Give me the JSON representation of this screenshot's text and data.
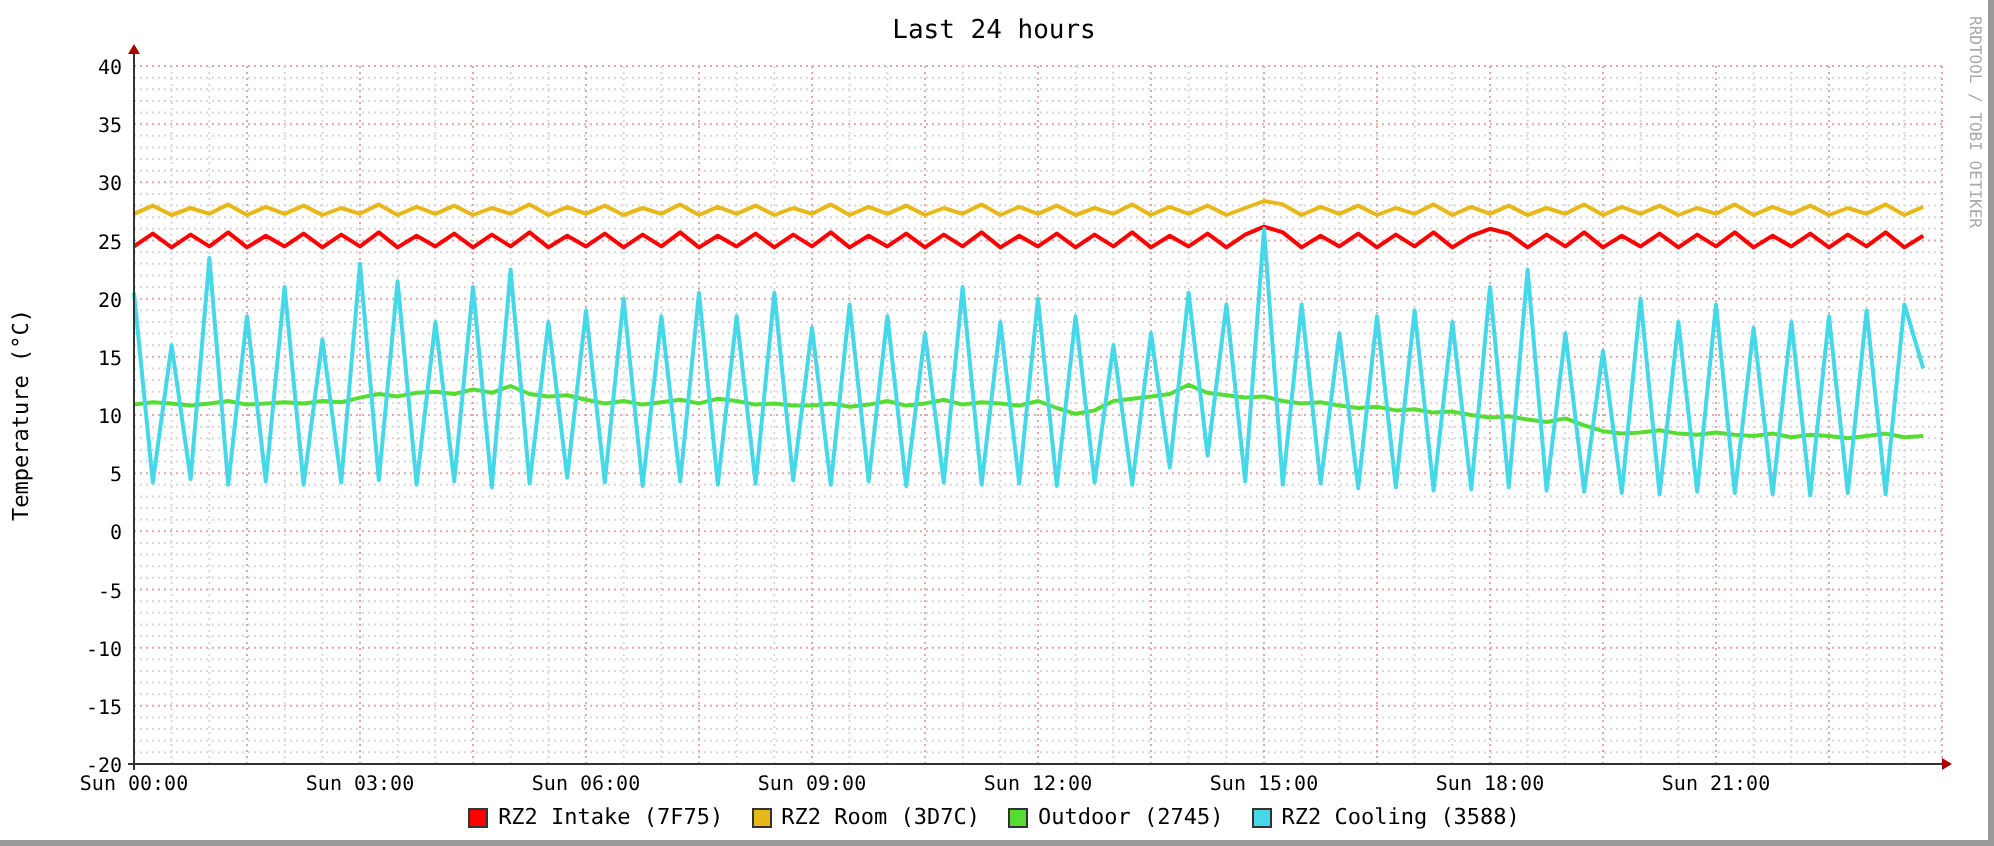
{
  "credit": "RRDTOOL / TOBI OETIKER",
  "chart_data": {
    "type": "line",
    "title": "Last 24 hours",
    "ylabel": "Temperature (°C)",
    "categories": [
      "Sun 00:00",
      null,
      null,
      null,
      null,
      null,
      null,
      null,
      null,
      null,
      null,
      null,
      "Sun 03:00",
      null,
      null,
      null,
      null,
      null,
      null,
      null,
      null,
      null,
      null,
      null,
      "Sun 06:00",
      null,
      null,
      null,
      null,
      null,
      null,
      null,
      null,
      null,
      null,
      null,
      "Sun 09:00",
      null,
      null,
      null,
      null,
      null,
      null,
      null,
      null,
      null,
      null,
      null,
      "Sun 12:00",
      null,
      null,
      null,
      null,
      null,
      null,
      null,
      null,
      null,
      null,
      null,
      "Sun 15:00",
      null,
      null,
      null,
      null,
      null,
      null,
      null,
      null,
      null,
      null,
      null,
      "Sun 18:00",
      null,
      null,
      null,
      null,
      null,
      null,
      null,
      null,
      null,
      null,
      null,
      "Sun 21:00",
      null,
      null,
      null,
      null,
      null,
      null,
      null,
      null,
      null,
      null,
      null
    ],
    "series": [
      {
        "name": "RZ2 Intake (7F75)",
        "color": "#ff0000",
        "values": [
          24.5,
          25.6,
          24.4,
          25.5,
          24.5,
          25.7,
          24.4,
          25.4,
          24.5,
          25.6,
          24.4,
          25.5,
          24.5,
          25.7,
          24.4,
          25.4,
          24.5,
          25.6,
          24.4,
          25.5,
          24.5,
          25.7,
          24.4,
          25.4,
          24.5,
          25.6,
          24.4,
          25.5,
          24.5,
          25.7,
          24.4,
          25.4,
          24.5,
          25.6,
          24.4,
          25.5,
          24.5,
          25.7,
          24.4,
          25.4,
          24.5,
          25.6,
          24.4,
          25.5,
          24.5,
          25.7,
          24.4,
          25.4,
          24.5,
          25.6,
          24.4,
          25.5,
          24.5,
          25.7,
          24.4,
          25.4,
          24.5,
          25.6,
          24.4,
          25.5,
          26.2,
          25.7,
          24.4,
          25.4,
          24.5,
          25.6,
          24.4,
          25.5,
          24.5,
          25.7,
          24.4,
          25.4,
          26.0,
          25.6,
          24.4,
          25.5,
          24.5,
          25.7,
          24.4,
          25.4,
          24.5,
          25.6,
          24.4,
          25.5,
          24.5,
          25.7,
          24.4,
          25.4,
          24.5,
          25.6,
          24.4,
          25.5,
          24.5,
          25.7,
          24.4,
          25.4
        ]
      },
      {
        "name": "RZ2 Room (3D7C)",
        "color": "#e8b818",
        "values": [
          27.3,
          28.0,
          27.2,
          27.8,
          27.3,
          28.1,
          27.2,
          27.9,
          27.3,
          28.0,
          27.2,
          27.8,
          27.3,
          28.1,
          27.2,
          27.9,
          27.3,
          28.0,
          27.2,
          27.8,
          27.3,
          28.1,
          27.2,
          27.9,
          27.3,
          28.0,
          27.2,
          27.8,
          27.3,
          28.1,
          27.2,
          27.9,
          27.3,
          28.0,
          27.2,
          27.8,
          27.3,
          28.1,
          27.2,
          27.9,
          27.3,
          28.0,
          27.2,
          27.8,
          27.3,
          28.1,
          27.2,
          27.9,
          27.3,
          28.0,
          27.2,
          27.8,
          27.3,
          28.1,
          27.2,
          27.9,
          27.3,
          28.0,
          27.2,
          27.8,
          28.4,
          28.1,
          27.2,
          27.9,
          27.3,
          28.0,
          27.2,
          27.8,
          27.3,
          28.1,
          27.2,
          27.9,
          27.3,
          28.0,
          27.2,
          27.8,
          27.3,
          28.1,
          27.2,
          27.9,
          27.3,
          28.0,
          27.2,
          27.8,
          27.3,
          28.1,
          27.2,
          27.9,
          27.3,
          28.0,
          27.2,
          27.8,
          27.3,
          28.1,
          27.2,
          27.9
        ]
      },
      {
        "name": "Outdoor (2745)",
        "color": "#55dd33",
        "values": [
          10.9,
          11.1,
          11.0,
          10.8,
          11.0,
          11.2,
          10.9,
          11.0,
          11.1,
          11.0,
          11.2,
          11.1,
          11.5,
          11.8,
          11.6,
          11.9,
          12.0,
          11.8,
          12.2,
          11.9,
          12.5,
          11.8,
          11.6,
          11.7,
          11.3,
          11.0,
          11.2,
          10.9,
          11.1,
          11.3,
          11.0,
          11.4,
          11.2,
          10.9,
          11.0,
          10.8,
          10.8,
          11.0,
          10.7,
          10.9,
          11.2,
          10.8,
          11.0,
          11.3,
          10.9,
          11.1,
          11.0,
          10.8,
          11.2,
          10.6,
          10.1,
          10.4,
          11.2,
          11.4,
          11.6,
          11.8,
          12.6,
          11.9,
          11.7,
          11.5,
          11.6,
          11.2,
          11.0,
          11.1,
          10.8,
          10.6,
          10.7,
          10.4,
          10.5,
          10.2,
          10.3,
          10.0,
          9.8,
          9.9,
          9.6,
          9.4,
          9.7,
          9.1,
          8.6,
          8.4,
          8.5,
          8.7,
          8.4,
          8.3,
          8.5,
          8.3,
          8.2,
          8.4,
          8.1,
          8.3,
          8.2,
          8.0,
          8.2,
          8.4,
          8.1,
          8.2
        ]
      },
      {
        "name": "RZ2 Cooling (3588)",
        "color": "#44d8e8",
        "values": [
          20.5,
          4.2,
          16.0,
          4.5,
          23.5,
          4.0,
          18.5,
          4.3,
          21.0,
          4.0,
          16.5,
          4.2,
          23.0,
          4.4,
          21.5,
          4.0,
          18.0,
          4.3,
          21.0,
          3.8,
          22.5,
          4.1,
          18.0,
          4.6,
          19.0,
          4.2,
          20.0,
          3.9,
          18.5,
          4.3,
          20.5,
          4.0,
          18.5,
          4.1,
          20.5,
          4.4,
          17.5,
          4.0,
          19.5,
          4.3,
          18.5,
          3.9,
          17.0,
          4.2,
          21.0,
          4.0,
          18.0,
          4.1,
          20.0,
          3.9,
          18.5,
          4.2,
          16.0,
          4.0,
          17.0,
          5.5,
          20.5,
          6.5,
          19.5,
          4.3,
          26.0,
          4.0,
          19.5,
          4.1,
          17.0,
          3.7,
          18.5,
          3.8,
          19.0,
          3.5,
          18.0,
          3.6,
          21.0,
          3.8,
          22.5,
          3.5,
          17.0,
          3.4,
          15.5,
          3.3,
          20.0,
          3.2,
          18.0,
          3.4,
          19.5,
          3.3,
          17.5,
          3.2,
          18.0,
          3.1,
          18.5,
          3.3,
          19.0,
          3.2,
          19.5,
          14.0
        ]
      }
    ],
    "ylim": [
      -20,
      40
    ],
    "grid": true,
    "yticks": [
      -20,
      -15,
      -10,
      -5,
      0,
      5,
      10,
      15,
      20,
      25,
      30,
      35,
      40
    ]
  }
}
